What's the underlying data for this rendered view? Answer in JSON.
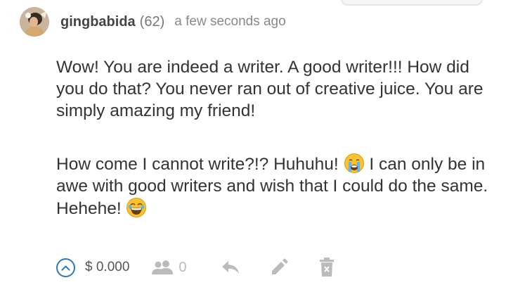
{
  "comment": {
    "author": "gingbabida",
    "reputation": "(62)",
    "timestamp": "a few seconds ago",
    "paragraph1": "Wow! You are indeed a writer. A good writer!!! How did you do that? You never ran out of creative juice. You are simply amazing my friend!",
    "paragraph2_part1": "How come I cannot write?!? Huhuhu!",
    "paragraph2_part2": "I can only be in awe with good writers and wish that I could do the same. Hehehe!"
  },
  "footer": {
    "payout": "$ 0.000",
    "voters_count": "0"
  },
  "icons": {
    "vote": "chevron-up-icon",
    "voters": "people-icon",
    "reply": "reply-icon",
    "edit": "pencil-icon",
    "delete": "trash-icon",
    "emoji1": "crying-face-emoji",
    "emoji2": "laughing-face-emoji"
  },
  "colors": {
    "vote_accent": "#2f78b5",
    "icon_gray": "#bbbbbb",
    "text": "#333333"
  }
}
